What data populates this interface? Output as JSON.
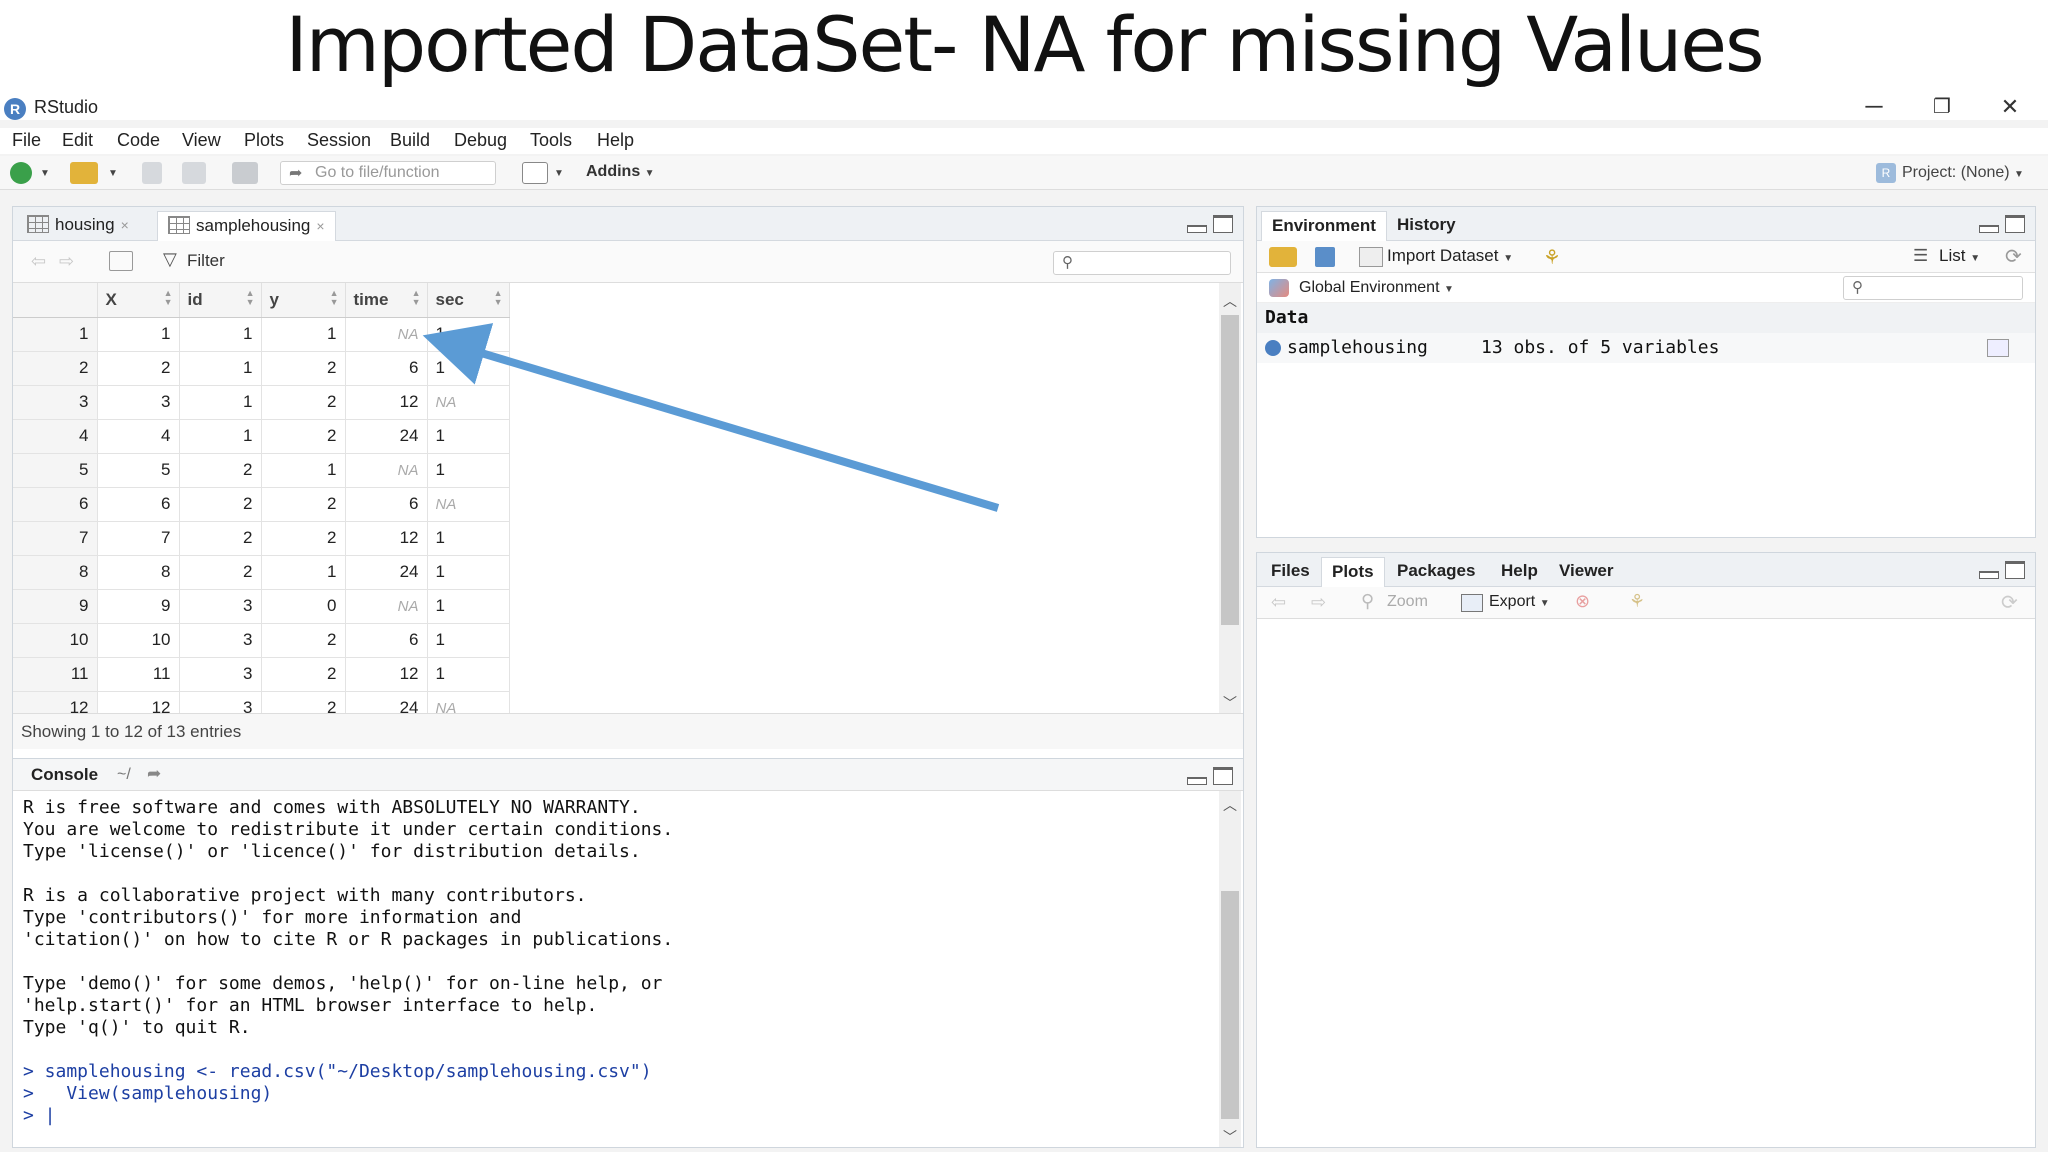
{
  "slide_title": "Imported DataSet- NA for missing Values",
  "app": {
    "title": "RStudio",
    "logo_letter": "R",
    "window_controls": {
      "minimize": "─",
      "restore": "❐",
      "close": "✕"
    },
    "menu": [
      "File",
      "Edit",
      "Code",
      "View",
      "Plots",
      "Session",
      "Build",
      "Debug",
      "Tools",
      "Help"
    ],
    "toolbar": {
      "goto_placeholder": "Go to file/function",
      "addins": "Addins",
      "project": "Project: (None)"
    }
  },
  "source_pane": {
    "tabs": [
      {
        "label": "housing"
      },
      {
        "label": "samplehousing"
      }
    ],
    "filter_label": "Filter",
    "columns": [
      "",
      "X",
      "id",
      "y",
      "time",
      "sec"
    ],
    "rows": [
      [
        "1",
        "1",
        "1",
        "1",
        "NA",
        "1"
      ],
      [
        "2",
        "2",
        "1",
        "2",
        "6",
        "1"
      ],
      [
        "3",
        "3",
        "1",
        "2",
        "12",
        "NA"
      ],
      [
        "4",
        "4",
        "1",
        "2",
        "24",
        "1"
      ],
      [
        "5",
        "5",
        "2",
        "1",
        "NA",
        "1"
      ],
      [
        "6",
        "6",
        "2",
        "2",
        "6",
        "NA"
      ],
      [
        "7",
        "7",
        "2",
        "2",
        "12",
        "1"
      ],
      [
        "8",
        "8",
        "2",
        "1",
        "24",
        "1"
      ],
      [
        "9",
        "9",
        "3",
        "0",
        "NA",
        "1"
      ],
      [
        "10",
        "10",
        "3",
        "2",
        "6",
        "1"
      ],
      [
        "11",
        "11",
        "3",
        "2",
        "12",
        "1"
      ],
      [
        "12",
        "12",
        "3",
        "2",
        "24",
        "NA"
      ]
    ],
    "status": "Showing 1 to 12 of 13 entries",
    "tab_close_glyph": "×"
  },
  "console_pane": {
    "tab_label": "Console",
    "path": "~/",
    "lines": [
      "R is free software and comes with ABSOLUTELY NO WARRANTY.",
      "You are welcome to redistribute it under certain conditions.",
      "Type 'license()' or 'licence()' for distribution details.",
      "",
      "R is a collaborative project with many contributors.",
      "Type 'contributors()' for more information and",
      "'citation()' on how to cite R or R packages in publications.",
      "",
      "Type 'demo()' for some demos, 'help()' for on-line help, or",
      "'help.start()' for an HTML browser interface to help.",
      "Type 'q()' to quit R.",
      ""
    ],
    "commands": [
      "> samplehousing <- read.csv(\"~/Desktop/samplehousing.csv\")",
      ">   View(samplehousing)",
      "> |"
    ]
  },
  "env_pane": {
    "tabs": [
      "Environment",
      "History"
    ],
    "import_label": "Import Dataset",
    "list_label": "List",
    "scope_label": "Global Environment",
    "section_label": "Data",
    "objects": [
      {
        "name": "samplehousing",
        "summary": "13 obs. of 5 variables"
      }
    ]
  },
  "files_pane": {
    "tabs": [
      "Files",
      "Plots",
      "Packages",
      "Help",
      "Viewer"
    ],
    "zoom_label": "Zoom",
    "export_label": "Export"
  },
  "colors": {
    "arrow": "#5b9bd5",
    "accent": "#4a7fc1",
    "na_text": "#aaaaaa"
  }
}
